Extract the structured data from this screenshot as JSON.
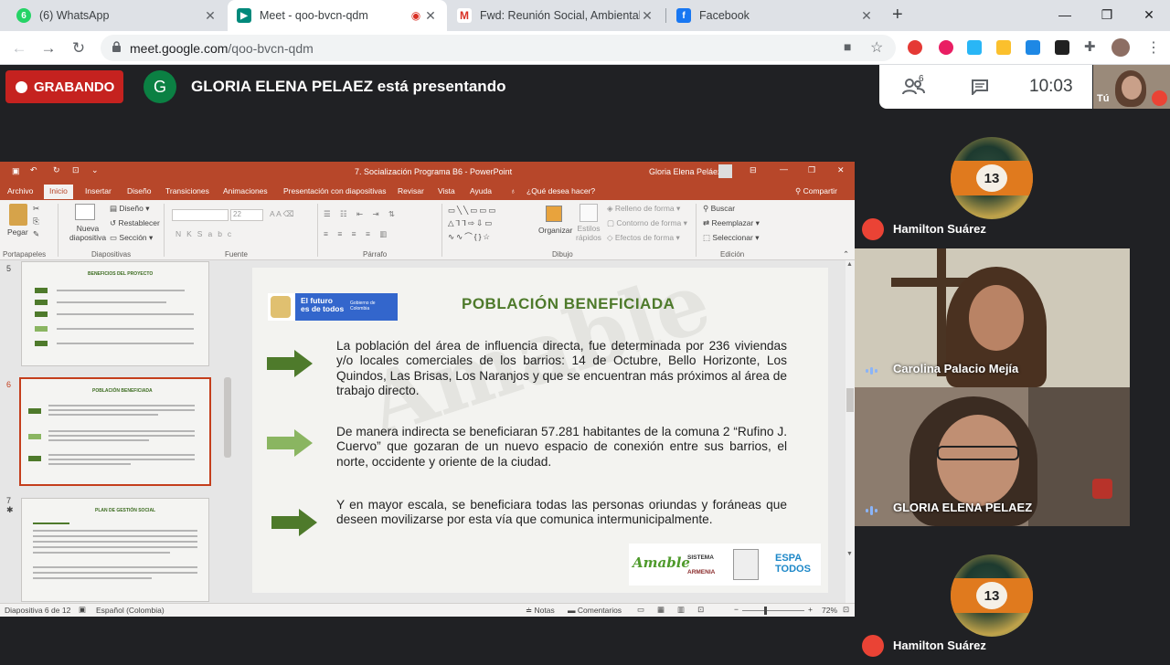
{
  "browser": {
    "tabs": [
      {
        "title": "(6) WhatsApp",
        "icon": "whatsapp-icon"
      },
      {
        "title": "Meet - qoo-bvcn-qdm",
        "icon": "meet-icon"
      },
      {
        "title": "Fwd: Reunión Social, Ambiental, I",
        "icon": "gmail-icon"
      },
      {
        "title": "Facebook",
        "icon": "facebook-icon"
      }
    ],
    "url_host": "meet.google.com",
    "url_path": "/qoo-bvcn-qdm"
  },
  "meet": {
    "recording_label": "GRABANDO",
    "presenter_initial": "G",
    "presenting_text": "GLORIA ELENA PELAEZ está presentando",
    "participant_count": "6",
    "time": "10:03",
    "self_label": "Tú"
  },
  "ppt": {
    "window_title": "7. Socialización Programa B6  -  PowerPoint",
    "user_name": "Gloria Elena Peláez",
    "ribbon_tabs": [
      "Archivo",
      "Inicio",
      "Insertar",
      "Diseño",
      "Transiciones",
      "Animaciones",
      "Presentación con diapositivas",
      "Revisar",
      "Vista",
      "Ayuda"
    ],
    "tell_me": "¿Qué desea hacer?",
    "share": "Compartir",
    "groups": {
      "clipboard": "Portapapeles",
      "slides": "Diapositivas",
      "font": "Fuente",
      "paragraph": "Párrafo",
      "drawing": "Dibujo",
      "editing": "Edición"
    },
    "buttons": {
      "paste": "Pegar",
      "new_slide": "Nueva diapositiva",
      "layout": "Diseño",
      "reset": "Restablecer",
      "section": "Sección",
      "font_size": "22",
      "arrange": "Organizar",
      "quick_styles": "Estilos rápidos",
      "shape_fill": "Relleno de forma",
      "shape_outline": "Contorno de forma",
      "shape_effects": "Efectos de forma",
      "find": "Buscar",
      "replace": "Reemplazar",
      "select": "Seleccionar"
    },
    "thumbnails": [
      {
        "number": "5",
        "title": "BENEFICIOS DEL PROYECTO"
      },
      {
        "number": "6",
        "title": "POBLACIÓN BENEFICIADA"
      },
      {
        "number": "7",
        "title": "PLAN DE GESTIÓN SOCIAL"
      }
    ],
    "slide": {
      "title": "POBLACIÓN  BENEFICIADA",
      "gov_logo_line1": "El futuro",
      "gov_logo_line2": "es de todos",
      "gov_logo_small": "Gobierno de Colombia",
      "paragraphs": [
        "La población del área de influencia directa, fue determinada por 236 viviendas y/o locales comerciales de los barrios:  14 de Octubre, Bello Horizonte, Los Quindos, Las Brisas, Los Naranjos y que se encuentran más próximos al área de trabajo directo.",
        "De manera indirecta se beneficiaran 57.281 habitantes de la comuna 2 “Rufino J. Cuervo” que gozaran de un nuevo espacio de conexión entre sus barrios,  el norte, occidente y oriente de la ciudad.",
        "Y en mayor escala, se beneficiara todas las personas oriundas y foráneas que deseen movilizarse por esta vía que comunica intermunicipalmente."
      ],
      "footer_logo1": "Amable",
      "footer_logo2_line1": "SISTEMA",
      "footer_logo2_line2": "ARMENIA",
      "footer_logo3": "ESPA TODOS"
    },
    "status": {
      "slide_counter": "Diapositiva 6 de 12",
      "language": "Español (Colombia)",
      "notes": "Notas",
      "comments": "Comentarios",
      "zoom": "72%"
    }
  },
  "participants": [
    {
      "name": "Hamilton Suárez",
      "muted": true
    },
    {
      "name": "Carolina Palacio Mejía",
      "muted": false
    },
    {
      "name": "GLORIA ELENA PELAEZ",
      "muted": false
    },
    {
      "name": "Hamilton Suárez",
      "muted": true
    }
  ]
}
